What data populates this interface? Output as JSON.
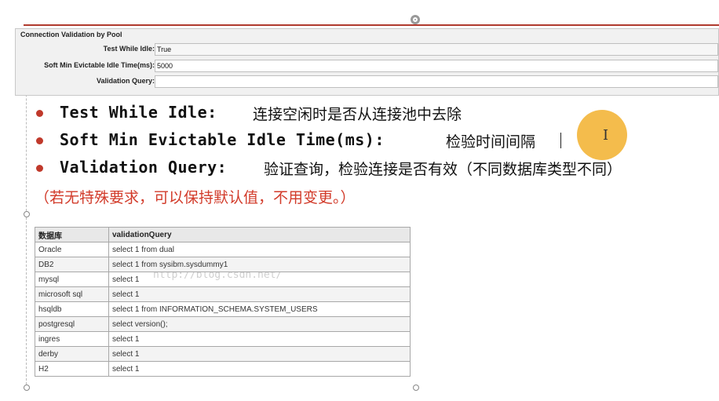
{
  "panel": {
    "title": "Connection Validation by Pool",
    "rows": [
      {
        "label": "Test While Idle:",
        "value": "True"
      },
      {
        "label": "Soft Min Evictable Idle Time(ms):",
        "value": "5000"
      },
      {
        "label": "Validation Query:",
        "value": ""
      }
    ]
  },
  "bullets": [
    {
      "term": "Test While Idle:",
      "desc": "连接空闲时是否从连接池中去除"
    },
    {
      "term": "Soft Min Evictable Idle Time(ms):",
      "desc": "检验时间间隔"
    },
    {
      "term": "Validation Query:",
      "desc": "验证查询，检验连接是否有效（不同数据库类型不同）"
    }
  ],
  "note": "（若无特殊要求，可以保持默认值，不用变更。）",
  "watermark": "http://blog.csdn.net/",
  "table": {
    "headers": [
      "数据库",
      "validationQuery"
    ],
    "rows": [
      [
        "Oracle",
        "select 1 from dual"
      ],
      [
        "DB2",
        "select 1 from sysibm.sysdummy1"
      ],
      [
        "mysql",
        "select 1"
      ],
      [
        "microsoft sql",
        "select 1"
      ],
      [
        "hsqldb",
        "select 1 from INFORMATION_SCHEMA.SYSTEM_USERS"
      ],
      [
        "postgresql",
        "select version();"
      ],
      [
        "ingres",
        "select 1"
      ],
      [
        "derby",
        "select 1"
      ],
      [
        "H2",
        "select 1"
      ]
    ]
  },
  "colors": {
    "accent": "#c0392b",
    "note": "#d23b2a",
    "cursor": "#f3b63d"
  },
  "icons": {
    "rotate": "rotate-handle-icon",
    "cursor": "text-cursor-icon"
  }
}
